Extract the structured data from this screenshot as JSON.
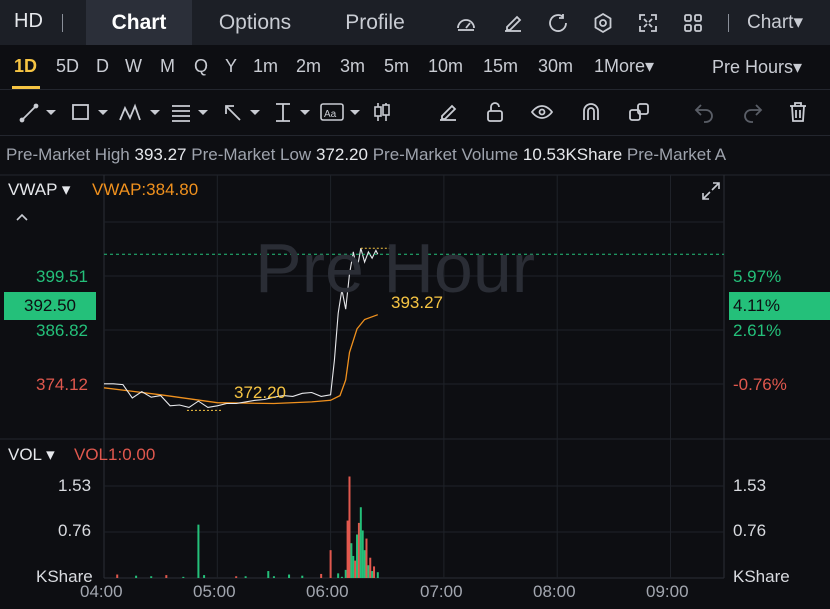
{
  "header": {
    "symbol": "HD",
    "tabs": [
      {
        "label": "Chart",
        "active": true
      },
      {
        "label": "Options",
        "active": false
      },
      {
        "label": "Profile",
        "active": false
      }
    ],
    "icons": [
      "gauge-icon",
      "edit-icon",
      "refresh-icon",
      "settings-icon",
      "fullscreen-icon",
      "layout-grid-icon"
    ],
    "chart_type_label": "Chart▾"
  },
  "intervals": {
    "items": [
      "1D",
      "5D",
      "D",
      "W",
      "M",
      "Q",
      "Y",
      "1m",
      "2m",
      "3m",
      "5m",
      "10m",
      "15m",
      "30m",
      "1More▾"
    ],
    "active": "1D",
    "session_label": "Pre Hours▾"
  },
  "stats": {
    "high_label": "Pre-Market High",
    "high_value": "393.27",
    "low_label": "Pre-Market Low",
    "low_value": "372.20",
    "volume_label": "Pre-Market Volume",
    "volume_value": "10.53KShare",
    "avg_label": "Pre-Market A"
  },
  "main_chart": {
    "indicator_label": "VWAP ▾",
    "vwap_value": "VWAP:384.80",
    "watermark": "Pre Hour",
    "left_axis": [
      "399.51",
      "386.82",
      "374.12"
    ],
    "current_price": "392.50",
    "right_axis": [
      "5.97%",
      "2.61%",
      "-0.76%"
    ],
    "current_pct": "4.11%",
    "high_annotation": "393.27",
    "low_annotation": "372.20"
  },
  "volume_chart": {
    "indicator_label": "VOL ▾",
    "vol_value": "VOL1:0.00",
    "left_axis": [
      "1.53",
      "0.76",
      "KShare"
    ],
    "right_axis": [
      "1.53",
      "0.76",
      "KShare"
    ]
  },
  "colors": {
    "up": "#24c07a",
    "down": "#e0584e",
    "accent": "#f6c443",
    "vwap": "#f0911e"
  },
  "chart_data": {
    "type": "line",
    "x_ticks": [
      "04:00",
      "05:00",
      "06:00",
      "07:00",
      "08:00",
      "09:00"
    ],
    "price": [
      [
        "04:00",
        376.0
      ],
      [
        "04:05",
        376.0
      ],
      [
        "04:10",
        375.9
      ],
      [
        "04:15",
        374.2
      ],
      [
        "04:20",
        375.0
      ],
      [
        "04:25",
        374.3
      ],
      [
        "04:30",
        374.5
      ],
      [
        "04:35",
        373.2
      ],
      [
        "04:40",
        373.3
      ],
      [
        "04:45",
        373.0
      ],
      [
        "04:50",
        373.8
      ],
      [
        "04:55",
        373.0
      ],
      [
        "05:00",
        373.2
      ],
      [
        "05:05",
        373.5
      ],
      [
        "05:10",
        373.5
      ],
      [
        "05:15",
        373.7
      ],
      [
        "05:20",
        373.9
      ],
      [
        "05:25",
        374.0
      ],
      [
        "05:30",
        374.3
      ],
      [
        "05:35",
        374.5
      ],
      [
        "05:40",
        374.4
      ],
      [
        "05:45",
        374.8
      ],
      [
        "05:50",
        374.9
      ],
      [
        "05:55",
        374.4
      ],
      [
        "06:00",
        374.6
      ],
      [
        "06:02",
        379.0
      ],
      [
        "06:04",
        385.0
      ],
      [
        "06:06",
        388.0
      ],
      [
        "06:08",
        385.5
      ],
      [
        "06:10",
        390.0
      ],
      [
        "06:12",
        392.8
      ],
      [
        "06:14",
        390.5
      ],
      [
        "06:16",
        393.27
      ],
      [
        "06:18",
        391.5
      ],
      [
        "06:20",
        392.8
      ],
      [
        "06:22",
        392.0
      ],
      [
        "06:24",
        393.0
      ],
      [
        "06:25",
        392.5
      ]
    ],
    "vwap": [
      [
        "04:00",
        375.5
      ],
      [
        "04:30",
        374.6
      ],
      [
        "05:00",
        373.6
      ],
      [
        "05:30",
        373.5
      ],
      [
        "05:50",
        373.7
      ],
      [
        "06:00",
        373.9
      ],
      [
        "06:05",
        374.5
      ],
      [
        "06:08",
        376.5
      ],
      [
        "06:10",
        380.0
      ],
      [
        "06:14",
        383.0
      ],
      [
        "06:18",
        384.2
      ],
      [
        "06:25",
        384.8
      ]
    ],
    "volume": [
      [
        "04:07",
        0.06,
        "down"
      ],
      [
        "04:17",
        0.04,
        "up"
      ],
      [
        "04:25",
        0.03,
        "up"
      ],
      [
        "04:33",
        0.05,
        "down"
      ],
      [
        "04:42",
        0.02,
        "up"
      ],
      [
        "04:50",
        0.92,
        "up"
      ],
      [
        "04:53",
        0.05,
        "up"
      ],
      [
        "05:10",
        0.03,
        "down"
      ],
      [
        "05:15",
        0.03,
        "up"
      ],
      [
        "05:27",
        0.12,
        "up"
      ],
      [
        "05:30",
        0.03,
        "up"
      ],
      [
        "05:38",
        0.06,
        "up"
      ],
      [
        "05:45",
        0.04,
        "up"
      ],
      [
        "05:55",
        0.07,
        "down"
      ],
      [
        "06:00",
        0.48,
        "down"
      ],
      [
        "06:04",
        0.08,
        "up"
      ],
      [
        "06:06",
        0.02,
        "up"
      ],
      [
        "06:08",
        0.14,
        "up"
      ],
      [
        "06:09",
        0.99,
        "down"
      ],
      [
        "06:10",
        1.75,
        "down"
      ],
      [
        "06:11",
        0.6,
        "up"
      ],
      [
        "06:12",
        0.38,
        "up"
      ],
      [
        "06:13",
        0.3,
        "down"
      ],
      [
        "06:14",
        0.75,
        "up"
      ],
      [
        "06:15",
        0.95,
        "down"
      ],
      [
        "06:16",
        1.22,
        "up"
      ],
      [
        "06:17",
        0.82,
        "up"
      ],
      [
        "06:18",
        0.48,
        "up"
      ],
      [
        "06:19",
        0.68,
        "down"
      ],
      [
        "06:20",
        0.22,
        "up"
      ],
      [
        "06:21",
        0.35,
        "down"
      ],
      [
        "06:22",
        0.12,
        "up"
      ],
      [
        "06:23",
        0.2,
        "down"
      ],
      [
        "06:25",
        0.1,
        "up"
      ]
    ],
    "price_range": [
      369.1,
      402.6
    ],
    "volume_range": [
      0,
      2.0
    ],
    "grid": true
  }
}
